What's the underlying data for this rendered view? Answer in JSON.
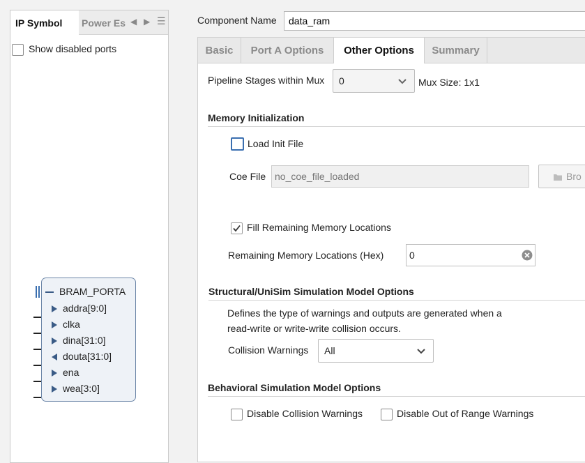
{
  "left_panel": {
    "tabs": [
      {
        "label": "IP Symbol",
        "active": true
      },
      {
        "label": "Power Es",
        "active": false
      }
    ],
    "show_disabled_ports": {
      "label": "Show disabled ports",
      "checked": false
    },
    "symbol": {
      "name": "BRAM_PORTA",
      "ports": [
        {
          "label": "addra[9:0]",
          "dir": "in"
        },
        {
          "label": "clka",
          "dir": "in"
        },
        {
          "label": "dina[31:0]",
          "dir": "in"
        },
        {
          "label": "douta[31:0]",
          "dir": "out"
        },
        {
          "label": "ena",
          "dir": "in"
        },
        {
          "label": "wea[3:0]",
          "dir": "in"
        }
      ]
    }
  },
  "component_name": {
    "label": "Component Name",
    "value": "data_ram"
  },
  "tabs": [
    {
      "label": "Basic",
      "active": false
    },
    {
      "label": "Port A Options",
      "active": false
    },
    {
      "label": "Other Options",
      "active": true
    },
    {
      "label": "Summary",
      "active": false
    }
  ],
  "pipeline": {
    "label": "Pipeline Stages within Mux",
    "value": "0",
    "mux_size": "Mux Size: 1x1"
  },
  "memory_init": {
    "title": "Memory Initialization",
    "load_init_file": {
      "label": "Load Init File",
      "checked": false
    },
    "coe_file": {
      "label": "Coe File",
      "placeholder": "no_coe_file_loaded",
      "browse_label": "Bro"
    },
    "fill_remaining": {
      "label": "Fill Remaining Memory Locations",
      "checked": true
    },
    "remaining_hex": {
      "label": "Remaining Memory Locations (Hex)",
      "value": "0"
    }
  },
  "structural": {
    "title": "Structural/UniSim Simulation Model Options",
    "description_line1": "Defines the type of warnings and outputs are generated when a",
    "description_line2": "read-write or write-write collision occurs.",
    "collision_warnings": {
      "label": "Collision Warnings",
      "value": "All"
    }
  },
  "behavioral": {
    "title": "Behavioral Simulation Model Options",
    "disable_collision": {
      "label": "Disable Collision Warnings",
      "checked": false
    },
    "disable_out_of_range": {
      "label": "Disable Out of Range Warnings",
      "checked": false
    }
  },
  "colors": {
    "accent": "#3a6fb0",
    "symbol_border": "#6c86a8",
    "port_arrow": "#3a5b86"
  }
}
